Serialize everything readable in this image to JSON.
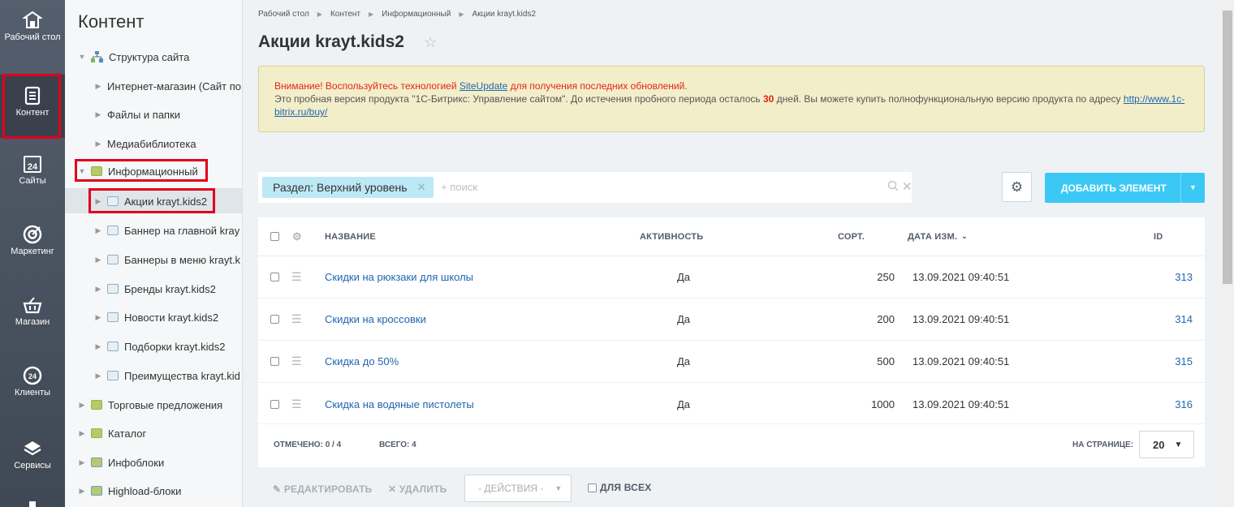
{
  "leftbar": [
    {
      "label": "Рабочий стол",
      "icon": "home-icon"
    },
    {
      "label": "Контент",
      "icon": "document-icon"
    },
    {
      "label": "Сайты",
      "icon": "calendar-24-icon"
    },
    {
      "label": "Маркетинг",
      "icon": "target-icon"
    },
    {
      "label": "Магазин",
      "icon": "shopping-basket-icon"
    },
    {
      "label": "Клиенты",
      "icon": "crm-24-icon"
    },
    {
      "label": "Сервисы",
      "icon": "layers-icon"
    }
  ],
  "tree": {
    "title": "Контент",
    "nodes": [
      {
        "label": "Структура сайта"
      },
      {
        "label": "Интернет-магазин (Сайт по"
      },
      {
        "label": "Файлы и папки"
      },
      {
        "label": "Медиабиблиотека"
      },
      {
        "label": "Информационный"
      },
      {
        "label": "Акции krayt.kids2"
      },
      {
        "label": "Баннер на главной kray"
      },
      {
        "label": "Баннеры в меню krayt.k"
      },
      {
        "label": "Бренды krayt.kids2"
      },
      {
        "label": "Новости krayt.kids2"
      },
      {
        "label": "Подборки krayt.kids2"
      },
      {
        "label": "Преимущества krayt.kid"
      },
      {
        "label": "Торговые предложения"
      },
      {
        "label": "Каталог"
      },
      {
        "label": "Инфоблоки"
      },
      {
        "label": "Highload-блоки"
      }
    ]
  },
  "breadcrumb": [
    "Рабочий стол",
    "Контент",
    "Информационный",
    "Акции krayt.kids2"
  ],
  "page_title": "Акции krayt.kids2",
  "notice": {
    "warn_prefix": "Внимание! Воспользуйтесь технологией ",
    "warn_link": "SiteUpdate",
    "warn_suffix": " для получения последних обновлений.",
    "trial_text_1": "Это пробная версия продукта \"1С-Битрикс: Управление сайтом\". До истечения пробного периода осталось ",
    "trial_days": "30",
    "trial_text_2": " дней. Вы можете купить полнофункциональную версию продукта по адресу ",
    "buy_link": "http://www.1c-bitrix.ru/buy/"
  },
  "filter": {
    "chip": "Раздел: Верхний уровень",
    "search_placeholder": "+ поиск"
  },
  "add_button": "ДОБАВИТЬ ЭЛЕМЕНТ",
  "table": {
    "headers": {
      "name": "НАЗВАНИЕ",
      "active": "АКТИВНОСТЬ",
      "sort": "СОРТ.",
      "date": "ДАТА ИЗМ.",
      "id": "ID"
    },
    "rows": [
      {
        "name": "Скидки на рюкзаки для школы",
        "active": "Да",
        "sort": "250",
        "date": "13.09.2021 09:40:51",
        "id": "313"
      },
      {
        "name": "Скидки на кроссовки",
        "active": "Да",
        "sort": "200",
        "date": "13.09.2021 09:40:51",
        "id": "314"
      },
      {
        "name": "Скидка до 50%",
        "active": "Да",
        "sort": "500",
        "date": "13.09.2021 09:40:51",
        "id": "315"
      },
      {
        "name": "Скидка на водяные пистолеты",
        "active": "Да",
        "sort": "1000",
        "date": "13.09.2021 09:40:51",
        "id": "316"
      }
    ],
    "footer": {
      "selected": "ОТМЕЧЕНО: 0 / 4",
      "total": "ВСЕГО: 4",
      "per_page_label": "НА СТРАНИЦЕ:",
      "per_page": "20"
    }
  },
  "actions": {
    "edit": "РЕДАКТИРОВАТЬ",
    "delete": "УДАЛИТЬ",
    "select": "- ДЕЙСТВИЯ -",
    "for_all": "ДЛЯ ВСЕХ"
  },
  "colors": {
    "accent": "#3bc8f5",
    "link": "#2067b0",
    "warning": "#e62515",
    "highlight_box": "#e0001b"
  }
}
